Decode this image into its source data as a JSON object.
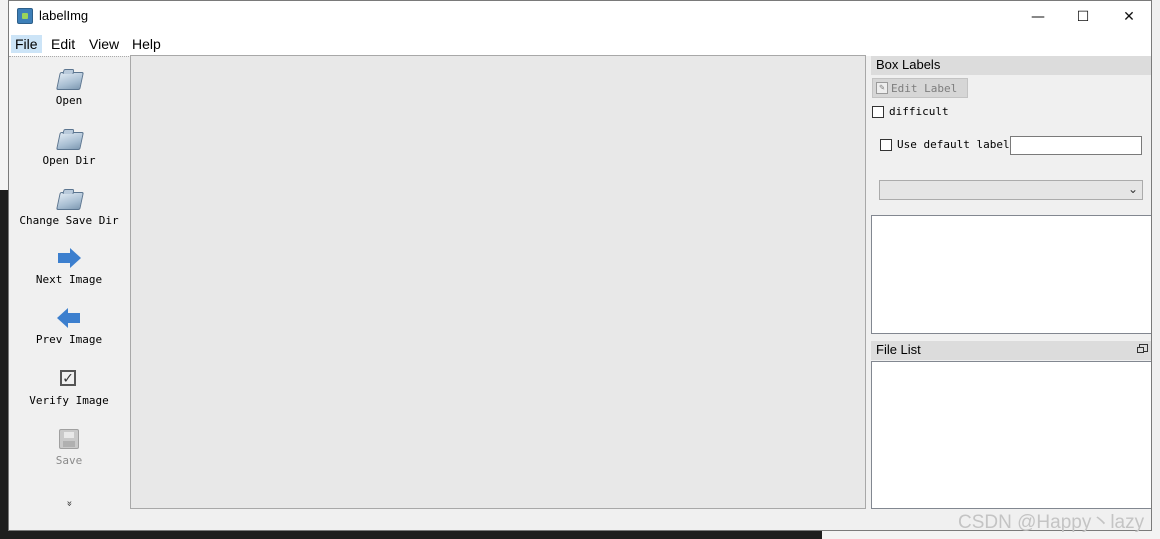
{
  "window": {
    "title": "labelImg",
    "minimize_glyph": "—",
    "maximize_glyph": "☐",
    "close_glyph": "✕"
  },
  "menu": {
    "items": [
      {
        "label": "File",
        "active": true
      },
      {
        "label": "Edit"
      },
      {
        "label": "View"
      },
      {
        "label": "Help"
      }
    ]
  },
  "toolbar": {
    "tools": [
      {
        "label": "Open",
        "icon": "folder-icon"
      },
      {
        "label": "Open Dir",
        "icon": "folder-icon"
      },
      {
        "label": "Change Save Dir",
        "icon": "folder-icon"
      },
      {
        "label": "Next Image",
        "icon": "arrow-right-icon"
      },
      {
        "label": "Prev Image",
        "icon": "arrow-left-icon"
      },
      {
        "label": "Verify Image",
        "icon": "check-icon"
      },
      {
        "label": "Save",
        "icon": "save-icon",
        "disabled": true
      }
    ],
    "more_glyph": "»"
  },
  "box_labels": {
    "title": "Box Labels",
    "edit_label_button": "Edit Label",
    "difficult_label": "difficult",
    "use_default_label": "Use default label",
    "default_label_value": ""
  },
  "file_list": {
    "title": "File List"
  },
  "watermark": "CSDN @Happy丶lazy",
  "colors": {
    "arrow_blue": "#3c7fce",
    "canvas_bg": "#e8e8e8",
    "dock_title_bg": "#dcdcdc"
  }
}
